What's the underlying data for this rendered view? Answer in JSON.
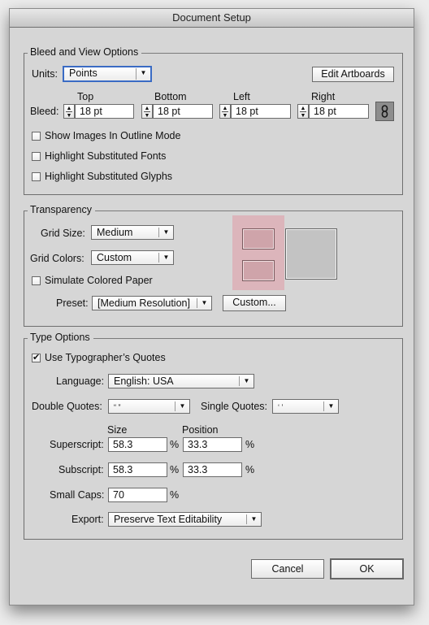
{
  "window": {
    "title": "Document Setup"
  },
  "bleed_view": {
    "title": "Bleed and View Options",
    "units_label": "Units:",
    "units_value": "Points",
    "edit_artboards": "Edit Artboards",
    "bleed_label": "Bleed:",
    "fields": [
      {
        "label": "Top",
        "value": "18 pt"
      },
      {
        "label": "Bottom",
        "value": "18 pt"
      },
      {
        "label": "Left",
        "value": "18 pt"
      },
      {
        "label": "Right",
        "value": "18 pt"
      }
    ],
    "link_icon": "chain-link-icon",
    "checkboxes": [
      {
        "label": "Show Images In Outline Mode",
        "checked": false
      },
      {
        "label": "Highlight Substituted Fonts",
        "checked": false
      },
      {
        "label": "Highlight Substituted Glyphs",
        "checked": false
      }
    ]
  },
  "transparency": {
    "title": "Transparency",
    "grid_size_label": "Grid Size:",
    "grid_size_value": "Medium",
    "grid_colors_label": "Grid Colors:",
    "grid_colors_value": "Custom",
    "simulate_paper": {
      "label": "Simulate Colored Paper",
      "checked": false
    },
    "preset_label": "Preset:",
    "preset_value": "[Medium Resolution]",
    "custom_button": "Custom...",
    "grid_color_1": "#dcb5bb",
    "grid_color_2": "#cfa4aa",
    "paper_color": "#c3c3c3"
  },
  "type_options": {
    "title": "Type Options",
    "typographers_quotes": {
      "label": "Use Typographer’s Quotes",
      "checked": true,
      "mark": "✔"
    },
    "language_label": "Language:",
    "language_value": "English: USA",
    "double_quotes_label": "Double Quotes:",
    "double_quotes_value": "“ ”",
    "single_quotes_label": "Single Quotes:",
    "single_quotes_value": "‘ ’",
    "size_header": "Size",
    "position_header": "Position",
    "superscript_label": "Superscript:",
    "superscript_size": "58.3",
    "superscript_position": "33.3",
    "subscript_label": "Subscript:",
    "subscript_size": "58.3",
    "subscript_position": "33.3",
    "small_caps_label": "Small Caps:",
    "small_caps_value": "70",
    "percent": "%",
    "export_label": "Export:",
    "export_value": "Preserve Text Editability"
  },
  "footer": {
    "cancel": "Cancel",
    "ok": "OK"
  },
  "glyphs": {
    "dropdown_arrow": "▼",
    "stepper_up": "▲",
    "stepper_down": "▼"
  }
}
